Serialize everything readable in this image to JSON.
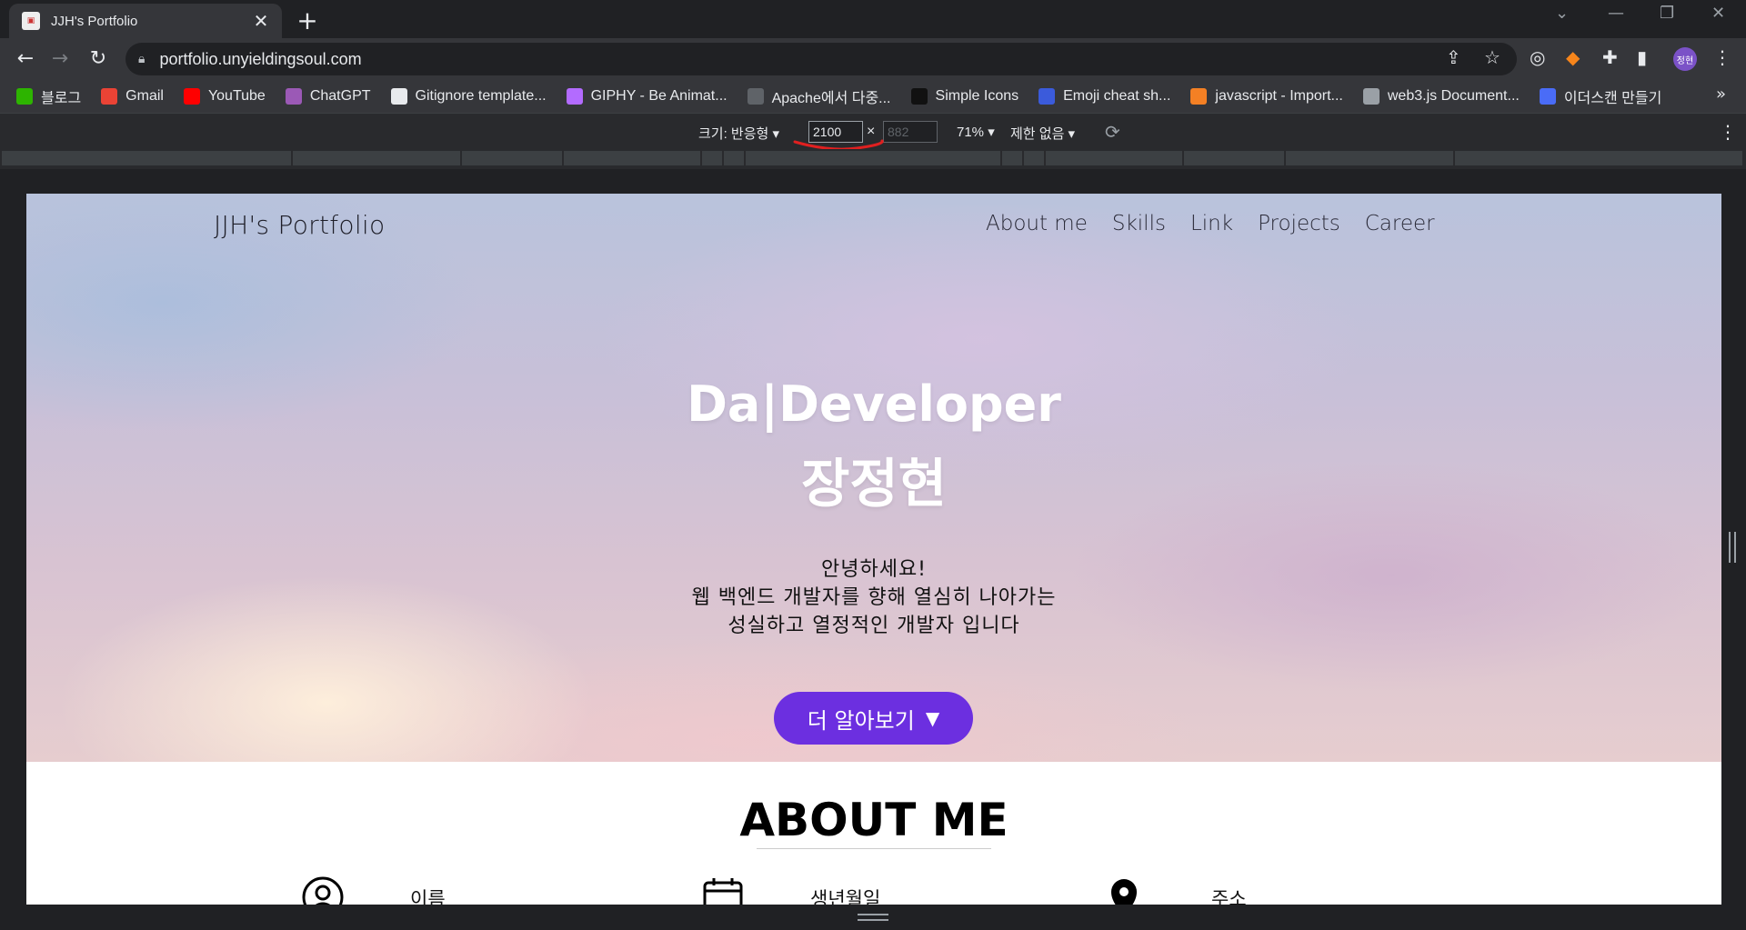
{
  "browser": {
    "tab_title": "JJH's Portfolio",
    "url": "portfolio.unyieldingsoul.com",
    "avatar_text": "정현",
    "bookmarks": [
      {
        "label": "블로그",
        "color": "#2db400"
      },
      {
        "label": "Gmail",
        "color": "#ea4335"
      },
      {
        "label": "YouTube",
        "color": "#ff0000"
      },
      {
        "label": "ChatGPT",
        "color": "#9b59b6"
      },
      {
        "label": "Gitignore template...",
        "color": "#e8eaed"
      },
      {
        "label": "GIPHY - Be Animat...",
        "color": "#b36bff"
      },
      {
        "label": "Apache에서 다중...",
        "color": "#5f6368"
      },
      {
        "label": "Simple Icons",
        "color": "#111111"
      },
      {
        "label": "Emoji cheat sh...",
        "color": "#3b5bdb"
      },
      {
        "label": "javascript - Import...",
        "color": "#f48024"
      },
      {
        "label": "web3.js Document...",
        "color": "#9aa0a6"
      },
      {
        "label": "이더스캔 만들기",
        "color": "#4a6cf7"
      }
    ]
  },
  "devtools": {
    "size_label": "크기: 반응형 ▾",
    "width": "2100",
    "height": "882",
    "times": "×",
    "zoom": "71% ▾",
    "throttle": "제한 없음 ▾"
  },
  "page": {
    "logo": "JJH's Portfolio",
    "menu": [
      "About me",
      "Skills",
      "Link",
      "Projects",
      "Career"
    ],
    "hero_title_line1": "Da|Developer",
    "hero_title_line2": "장정현",
    "intro_line1": "안녕하세요!",
    "intro_line2": "웹 백엔드 개발자를 향해 열심히 나아가는",
    "intro_line3": "성실하고 열정적인 개발자 입니다",
    "cta_label": "더 알아보기",
    "cta_arrow": "▼",
    "about_title": "ABOUT ME",
    "info": [
      {
        "label": "이름",
        "icon": "user-icon"
      },
      {
        "label": "생년월일",
        "icon": "calendar-icon"
      },
      {
        "label": "주소",
        "icon": "location-pin-icon"
      }
    ],
    "accent_color": "#6c2fe0"
  }
}
